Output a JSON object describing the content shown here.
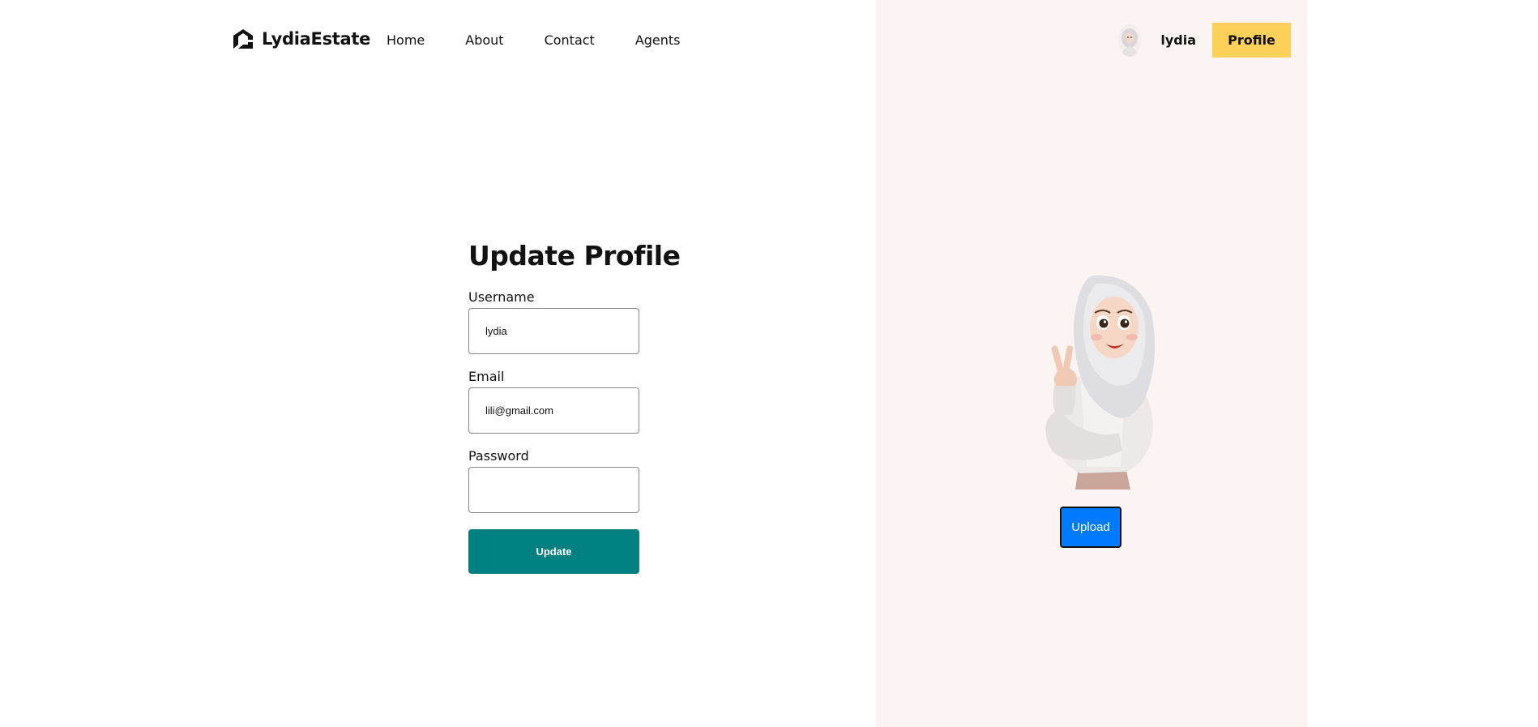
{
  "nav": {
    "brand": "LydiaEstate",
    "links": [
      "Home",
      "About",
      "Contact",
      "Agents"
    ],
    "user_name": "lydia",
    "profile_label": "Profile"
  },
  "form": {
    "title": "Update Profile",
    "fields": [
      {
        "label": "Username",
        "value": "lydia",
        "type": "text"
      },
      {
        "label": "Email",
        "value": "lili@gmail.com",
        "type": "email"
      },
      {
        "label": "Password",
        "value": "",
        "type": "password"
      }
    ],
    "submit_label": "Update"
  },
  "avatar": {
    "upload_label": "Upload"
  },
  "colors": {
    "profile_button": "#fdd05a",
    "update_button": "#008080",
    "upload_button": "#007bff",
    "right_panel_bg": "#fcf4f2"
  }
}
